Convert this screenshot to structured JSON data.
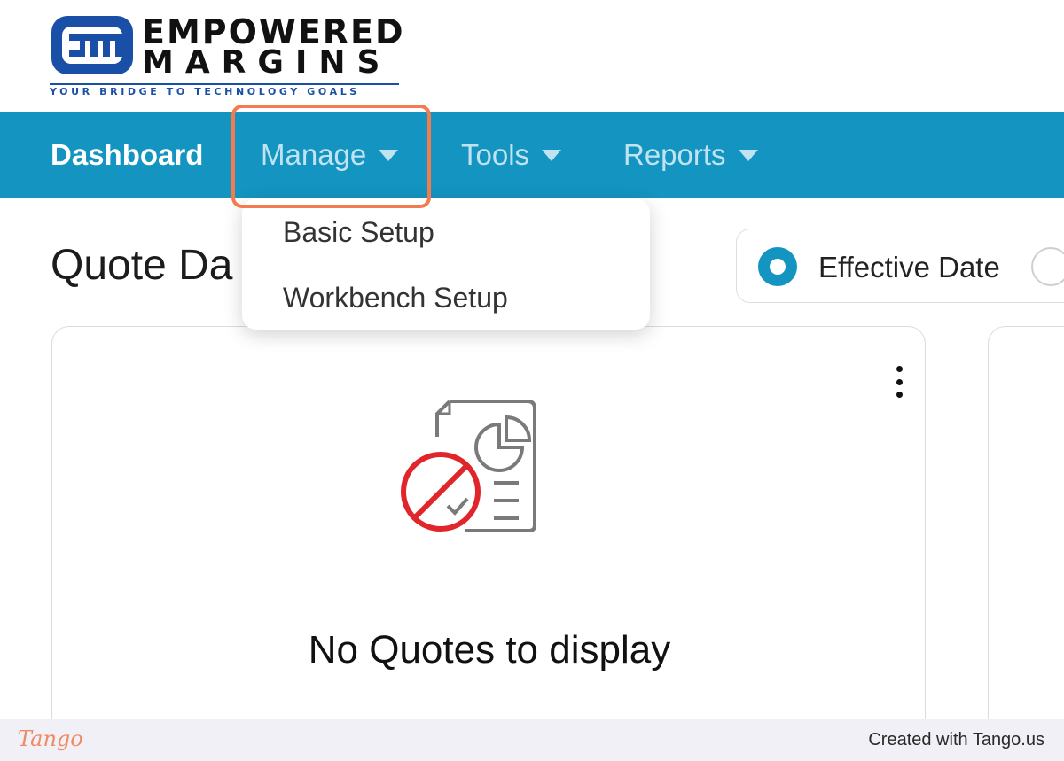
{
  "header": {
    "logo_line1": "EMPOWERED",
    "logo_line2": "MARGINS",
    "tagline": "YOUR BRIDGE TO TECHNOLOGY GOALS",
    "logo_icon": "em-logo-icon",
    "brand_colors": {
      "blue": "#1a4fa8",
      "dark": "#111111"
    }
  },
  "nav": {
    "background": "#1494c0",
    "items": [
      {
        "label": "Dashboard",
        "active": true,
        "has_dropdown": false
      },
      {
        "label": "Manage",
        "active": false,
        "has_dropdown": true
      },
      {
        "label": "Tools",
        "active": false,
        "has_dropdown": true
      },
      {
        "label": "Reports",
        "active": false,
        "has_dropdown": true
      }
    ],
    "highlight_color": "#f47b4f"
  },
  "dropdown": {
    "items": [
      {
        "label": "Basic Setup"
      },
      {
        "label": "Workbench Setup"
      }
    ]
  },
  "page": {
    "title_visible": "Quote Da",
    "date_filter": {
      "selected_label": "Effective Date"
    }
  },
  "card": {
    "empty_message": "No Quotes to display",
    "menu_icon": "kebab-menu-icon",
    "illustration_icon": "no-report-icon"
  },
  "footer": {
    "brand": "Tango",
    "created_text": "Created with Tango.us",
    "brand_color": "#f08a63"
  }
}
